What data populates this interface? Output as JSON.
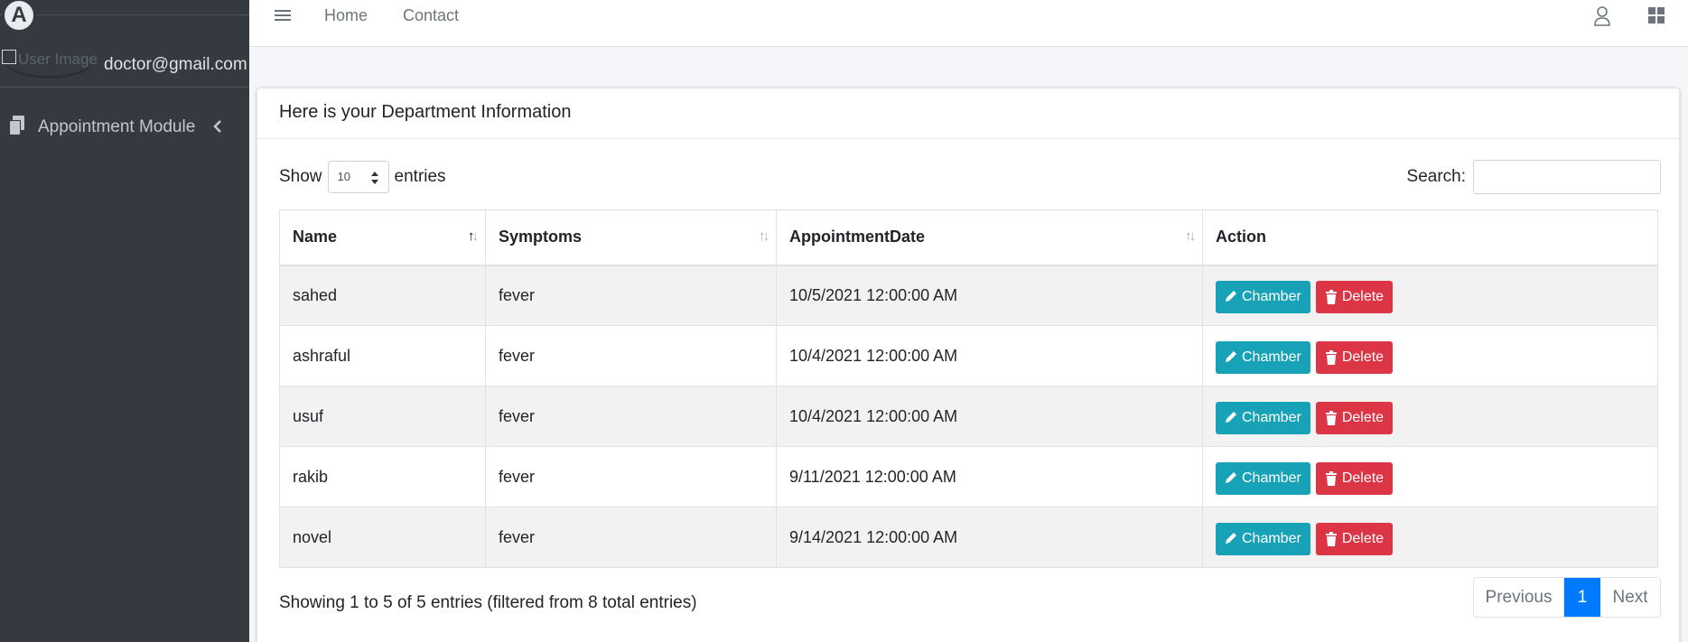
{
  "sidebar": {
    "logo_letter": "A",
    "user_image_alt": "User Image",
    "user_email": "doctor@gmail.com",
    "nav_items": [
      {
        "label": "Appointment Module",
        "icon": "copy-icon"
      }
    ]
  },
  "topnav": {
    "links": [
      {
        "label": "Home"
      },
      {
        "label": "Contact"
      }
    ]
  },
  "card": {
    "title": "Here is your Department Information"
  },
  "datatable": {
    "show_label": "Show",
    "page_length": "10",
    "entries_label": "entries",
    "search_label": "Search:",
    "search_value": "",
    "columns": [
      "Name",
      "Symptoms",
      "AppointmentDate",
      "Action"
    ],
    "sort_column": "Name",
    "rows": [
      {
        "name": "sahed",
        "symptoms": "fever",
        "date": "10/5/2021 12:00:00 AM"
      },
      {
        "name": "ashraful",
        "symptoms": "fever",
        "date": "10/4/2021 12:00:00 AM"
      },
      {
        "name": "usuf",
        "symptoms": "fever",
        "date": "10/4/2021 12:00:00 AM"
      },
      {
        "name": "rakib",
        "symptoms": "fever",
        "date": "9/11/2021 12:00:00 AM"
      },
      {
        "name": "novel",
        "symptoms": "fever",
        "date": "9/14/2021 12:00:00 AM"
      }
    ],
    "action_labels": {
      "chamber": "Chamber",
      "delete": "Delete"
    },
    "info": "Showing 1 to 5 of 5 entries (filtered from 8 total entries)",
    "pagination": {
      "previous": "Previous",
      "current": "1",
      "next": "Next"
    }
  },
  "colors": {
    "sidebar_bg": "#343a40",
    "chamber_btn": "#17a2b8",
    "delete_btn": "#dc3545",
    "active_page": "#007bff"
  }
}
